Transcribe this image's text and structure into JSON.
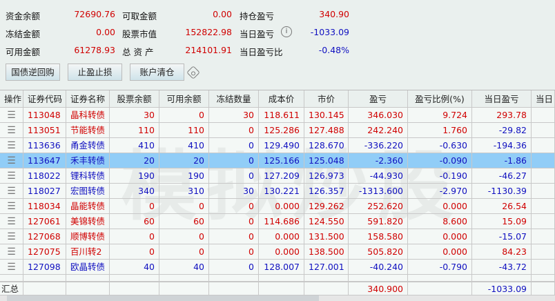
{
  "summary": {
    "col1": [
      {
        "label": "资金余额",
        "value": "72690.76",
        "c": "red"
      },
      {
        "label": "冻结金额",
        "value": "0.00",
        "c": "red"
      },
      {
        "label": "可用金额",
        "value": "61278.93",
        "c": "red"
      }
    ],
    "col2": [
      {
        "label": "可取金额",
        "value": "0.00",
        "c": "red"
      },
      {
        "label": "股票市值",
        "value": "152822.98",
        "c": "red"
      },
      {
        "label": "总 资 产",
        "value": "214101.91",
        "c": "red"
      }
    ],
    "col3": [
      {
        "label": "持仓盈亏",
        "value": "340.90",
        "c": "red"
      },
      {
        "label": "当日盈亏",
        "value": "-1033.09",
        "c": "blue"
      },
      {
        "label": "当日盈亏比",
        "value": "-0.48%",
        "c": "blue"
      }
    ],
    "info_icon": "i"
  },
  "buttons": [
    "国债逆回购",
    "止盈止损",
    "账户清仓"
  ],
  "watermark": "模拟炒股",
  "table": {
    "headers": [
      "操作",
      "证券代码",
      "证券名称",
      "股票余额",
      "可用余额",
      "冻结数量",
      "成本价",
      "市价",
      "盈亏",
      "盈亏比例(%)",
      "当日盈亏",
      "当日"
    ],
    "rows": [
      [
        "113048",
        "晶科转债",
        "30",
        "0",
        "30",
        "118.611",
        "130.145",
        "346.030",
        "9.724",
        "293.78"
      ],
      [
        "113051",
        "节能转债",
        "110",
        "110",
        "0",
        "125.286",
        "127.488",
        "242.240",
        "1.760",
        "-29.82"
      ],
      [
        "113636",
        "甬金转债",
        "410",
        "410",
        "0",
        "129.490",
        "128.670",
        "-336.220",
        "-0.630",
        "-194.36"
      ],
      [
        "113647",
        "禾丰转债",
        "20",
        "20",
        "0",
        "125.166",
        "125.048",
        "-2.360",
        "-0.090",
        "-1.86"
      ],
      [
        "118022",
        "锂科转债",
        "190",
        "190",
        "0",
        "127.209",
        "126.973",
        "-44.930",
        "-0.190",
        "-46.27"
      ],
      [
        "118027",
        "宏图转债",
        "340",
        "310",
        "30",
        "130.221",
        "126.357",
        "-1313.600",
        "-2.970",
        "-1130.39"
      ],
      [
        "118034",
        "晶能转债",
        "0",
        "0",
        "0",
        "0.000",
        "129.262",
        "252.620",
        "0.000",
        "26.54"
      ],
      [
        "127061",
        "美锦转债",
        "60",
        "60",
        "0",
        "114.686",
        "124.550",
        "591.820",
        "8.600",
        "15.09"
      ],
      [
        "127068",
        "顺博转债",
        "0",
        "0",
        "0",
        "0.000",
        "131.500",
        "158.580",
        "0.000",
        "-15.07"
      ],
      [
        "127075",
        "百川转2",
        "0",
        "0",
        "0",
        "0.000",
        "138.500",
        "505.820",
        "0.000",
        "84.23"
      ],
      [
        "127098",
        "欧晶转债",
        "40",
        "40",
        "0",
        "128.007",
        "127.001",
        "-40.240",
        "-0.790",
        "-43.72"
      ]
    ],
    "selected_row": 3,
    "total": {
      "label": "汇总",
      "pnl": "340.900",
      "day_pnl": "-1033.09"
    }
  },
  "colors": {
    "red": "#d00000",
    "blue": "#1010c0",
    "selected": "#91cdf7"
  }
}
